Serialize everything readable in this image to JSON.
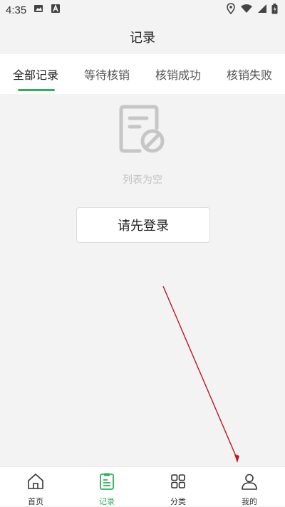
{
  "status_bar": {
    "time": "4:35"
  },
  "header": {
    "title": "记录"
  },
  "tabs": [
    {
      "label": "全部记录",
      "active": true
    },
    {
      "label": "等待核销",
      "active": false
    },
    {
      "label": "核销成功",
      "active": false
    },
    {
      "label": "核销失败",
      "active": false
    }
  ],
  "empty_state": {
    "message": "列表为空",
    "icon": "empty-list-icon"
  },
  "login_button": {
    "label": "请先登录"
  },
  "bottom_nav": [
    {
      "label": "首页",
      "icon": "home-icon",
      "active": false
    },
    {
      "label": "记录",
      "icon": "record-icon",
      "active": true
    },
    {
      "label": "分类",
      "icon": "category-icon",
      "active": false
    },
    {
      "label": "我的",
      "icon": "profile-icon",
      "active": false
    }
  ],
  "colors": {
    "accent": "#2fae5b",
    "background": "#f3f3f3",
    "annotation_arrow": "#c0171d"
  }
}
